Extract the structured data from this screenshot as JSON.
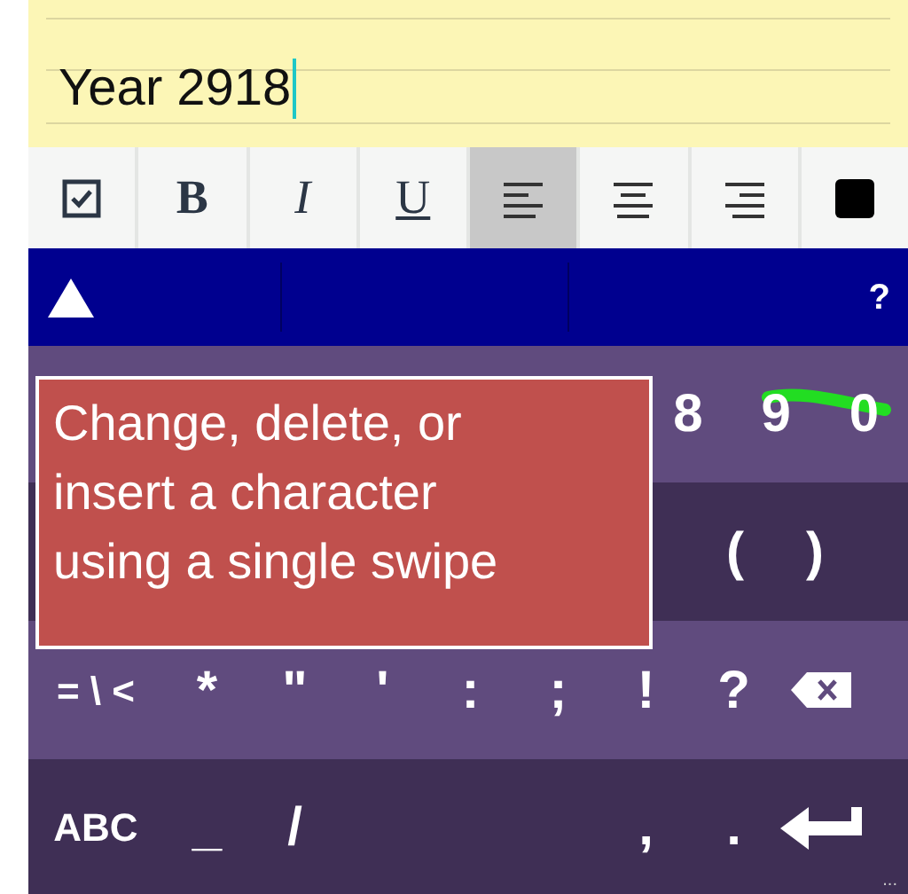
{
  "editor": {
    "text": "Year 2918"
  },
  "toolbar": [
    {
      "kind": "checkbox",
      "selected": false
    },
    {
      "kind": "bold",
      "label": "B",
      "selected": false
    },
    {
      "kind": "italic",
      "label": "I",
      "selected": false
    },
    {
      "kind": "underline",
      "label": "U",
      "selected": false
    },
    {
      "kind": "align-left",
      "selected": true
    },
    {
      "kind": "align-center",
      "selected": false
    },
    {
      "kind": "align-right",
      "selected": false
    },
    {
      "kind": "color",
      "color": "#000000",
      "selected": false
    }
  ],
  "suggestion_bar": {
    "help": "?"
  },
  "keyboard": {
    "rows": [
      {
        "keys": [
          {
            "kind": "char",
            "label": "8"
          },
          {
            "kind": "char",
            "label": "9"
          },
          {
            "kind": "char",
            "label": "0"
          }
        ]
      },
      {
        "keys": [
          {
            "kind": "char",
            "label": "("
          },
          {
            "kind": "char",
            "label": ")"
          }
        ]
      },
      {
        "keys": [
          {
            "kind": "small",
            "label": "= \\ <"
          },
          {
            "kind": "char",
            "label": "*"
          },
          {
            "kind": "char",
            "label": "\""
          },
          {
            "kind": "char",
            "label": "'"
          },
          {
            "kind": "char",
            "label": ":"
          },
          {
            "kind": "char",
            "label": ";"
          },
          {
            "kind": "char",
            "label": "!"
          },
          {
            "kind": "char",
            "label": "?"
          },
          {
            "kind": "backspace"
          }
        ]
      },
      {
        "keys": [
          {
            "kind": "small",
            "label": "ABC"
          },
          {
            "kind": "char",
            "label": "_"
          },
          {
            "kind": "char",
            "label": "/"
          }
        ],
        "right_keys": [
          {
            "kind": "char",
            "label": ","
          },
          {
            "kind": "char",
            "label": "."
          },
          {
            "kind": "enter"
          }
        ]
      }
    ],
    "corner_hint": "..."
  },
  "callout": {
    "text": "Change, delete, or\ninsert a character\nusing a single swipe"
  }
}
